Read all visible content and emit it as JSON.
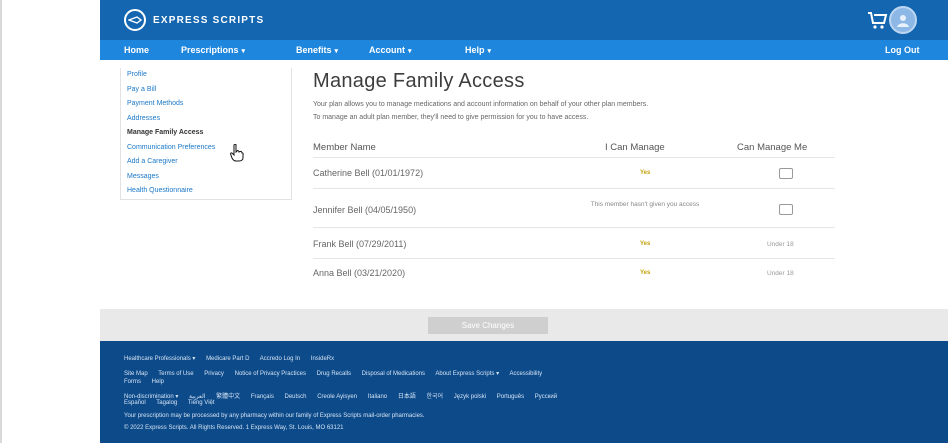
{
  "brand": {
    "name": "EXPRESS SCRIPTS",
    "logo_icon": "express-scripts-logo",
    "colors": {
      "topbar": "#1566b0",
      "navbar": "#1f86dd",
      "footer": "#0c4a8a",
      "link": "#1b78c8",
      "yes": "#c4a20a"
    }
  },
  "header": {
    "cart_icon": "cart-icon",
    "avatar_icon": "user-avatar"
  },
  "nav": {
    "items": [
      {
        "label": "Home"
      },
      {
        "label": "Prescriptions",
        "caret": "▾"
      },
      {
        "label": "Benefits",
        "caret": "▾"
      },
      {
        "label": "Account",
        "caret": "▾"
      },
      {
        "label": "Help",
        "caret": "▾"
      }
    ],
    "logout": "Log Out"
  },
  "sidebar": {
    "items": [
      {
        "label": "Profile"
      },
      {
        "label": "Pay a Bill"
      },
      {
        "label": "Payment Methods"
      },
      {
        "label": "Addresses"
      },
      {
        "label": "Manage Family Access",
        "active": true
      },
      {
        "label": "Communication Preferences"
      },
      {
        "label": "Add a Caregiver"
      },
      {
        "label": "Messages"
      },
      {
        "label": "Health Questionnaire"
      }
    ]
  },
  "main": {
    "title": "Manage Family Access",
    "description": [
      "Your plan allows you to manage medications and account information on behalf of your other plan members.",
      "To manage an adult plan member, they'll need to give permission for you to have access."
    ],
    "columns": [
      "Member Name",
      "I Can Manage",
      "Can Manage Me"
    ],
    "members": [
      {
        "name": "Catherine Bell (01/01/1972)",
        "i_can_manage": "Yes",
        "can_manage_me": "checkbox"
      },
      {
        "name": "Jennifer Bell (04/05/1950)",
        "i_can_manage": "This member hasn't given you access",
        "can_manage_me": "checkbox"
      },
      {
        "name": "Frank Bell (07/29/2011)",
        "i_can_manage": "Yes",
        "can_manage_me": "Under 18"
      },
      {
        "name": "Anna Bell (03/21/2020)",
        "i_can_manage": "Yes",
        "can_manage_me": "Under 18"
      }
    ]
  },
  "actions": {
    "save_label": "Save Changes"
  },
  "footer": {
    "row1": [
      "Healthcare Professionals ▾",
      "Medicare Part D",
      "Accredo Log In",
      "InsideRx"
    ],
    "row2": [
      "Site Map",
      "Terms of Use",
      "Privacy",
      "Notice of Privacy Practices",
      "Drug Recalls",
      "Disposal of Medications",
      "About Express Scripts ▾",
      "Accessibility"
    ],
    "row3": [
      "Forms",
      "Help"
    ],
    "row4": [
      "Non-discrimination ▾",
      "العربية",
      "繁體中文",
      "Français",
      "Deutsch",
      "Creole Ayisyen",
      "Italiano",
      "日本語",
      "한국어",
      "Język polski",
      "Português",
      "Pусский"
    ],
    "row5": [
      "Español",
      "Tagalog",
      "Tiếng Việt"
    ],
    "notice": "Your prescription may be processed by any pharmacy within our family of Express Scripts mail-order pharmacies.",
    "copyright": "© 2022 Express Scripts. All Rights Reserved. 1 Express Way, St. Louis, MO 63121"
  }
}
